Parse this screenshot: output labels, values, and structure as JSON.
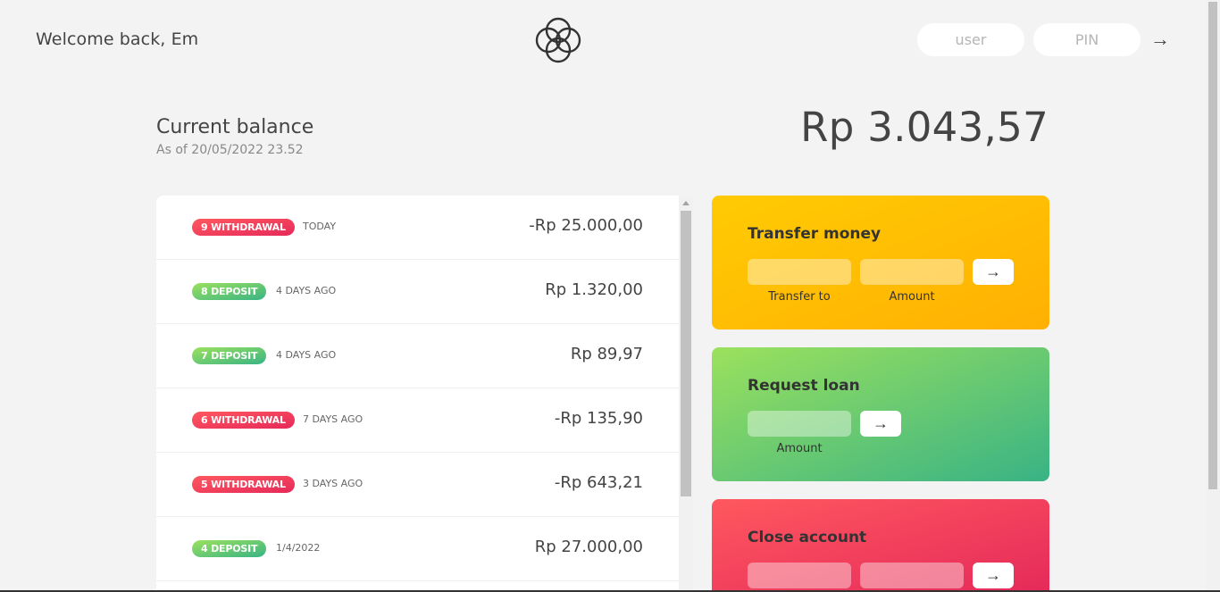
{
  "nav": {
    "welcome": "Welcome back, Em",
    "user_placeholder": "user",
    "pin_placeholder": "PIN",
    "login_arrow": "→"
  },
  "balance": {
    "label": "Current balance",
    "date_prefix": "As of",
    "date": "20/05/2022 23.52",
    "value": "Rp 3.043,57"
  },
  "movements": [
    {
      "type": "withdrawal",
      "badge": "9 WITHDRAWAL",
      "date": "TODAY",
      "value": "-Rp 25.000,00"
    },
    {
      "type": "deposit",
      "badge": "8 DEPOSIT",
      "date": "4 DAYS AGO",
      "value": "Rp 1.320,00"
    },
    {
      "type": "deposit",
      "badge": "7 DEPOSIT",
      "date": "4 DAYS AGO",
      "value": "Rp 89,97"
    },
    {
      "type": "withdrawal",
      "badge": "6 WITHDRAWAL",
      "date": "7 DAYS AGO",
      "value": "-Rp 135,90"
    },
    {
      "type": "withdrawal",
      "badge": "5 WITHDRAWAL",
      "date": "3 DAYS AGO",
      "value": "-Rp 643,21"
    },
    {
      "type": "deposit",
      "badge": "4 DEPOSIT",
      "date": "1/4/2022",
      "value": "Rp 27.000,00"
    }
  ],
  "operations": {
    "transfer": {
      "title": "Transfer money",
      "to_label": "Transfer to",
      "amount_label": "Amount",
      "button": "→"
    },
    "loan": {
      "title": "Request loan",
      "amount_label": "Amount",
      "button": "→"
    },
    "close": {
      "title": "Close account",
      "button": "→"
    }
  },
  "colors": {
    "background": "#f3f3f3",
    "withdrawal": "#e52a5a",
    "deposit": "#39b385",
    "transfer_card": "#ffb003",
    "loan_card": "#9be15d",
    "close_card": "#ff585f"
  }
}
